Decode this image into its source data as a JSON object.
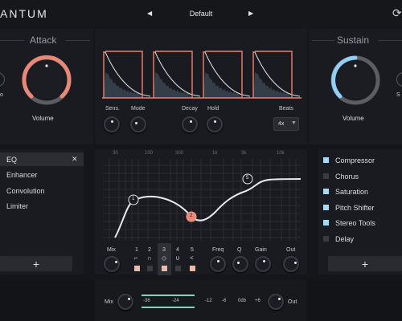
{
  "header": {
    "brand": "ANTUM",
    "preset_name": "Default",
    "prev_icon": "triangle-left-icon",
    "next_icon": "triangle-right-icon",
    "sync_icon": "refresh-icon"
  },
  "attack": {
    "title": "Attack",
    "volume_label": "Volume",
    "cut_label": "o"
  },
  "sustain": {
    "title": "Sustain",
    "volume_label": "Volume",
    "cut_label": "S"
  },
  "trigger": {
    "sens_label": "Sens.",
    "mode_label": "Mode",
    "decay_label": "Decay",
    "hold_label": "Hold",
    "beats_label": "Beats",
    "beats_value": "4x",
    "beats_options": [
      "4x"
    ]
  },
  "left_chain": {
    "items": [
      {
        "label": "EQ",
        "selected": true,
        "close": "✕"
      },
      {
        "label": "Enhancer",
        "selected": false
      },
      {
        "label": "Convolution",
        "selected": false
      },
      {
        "label": "Limiter",
        "selected": false
      }
    ],
    "add_label": "+"
  },
  "eq": {
    "freq_ticks": [
      "30",
      "100",
      "300",
      "1k",
      "3k",
      "10k"
    ],
    "node_labels": [
      "1",
      "2",
      "5"
    ],
    "band_numbers": [
      "1",
      "2",
      "3",
      "4",
      "5"
    ],
    "mix_label": "Mix",
    "freq_label": "Freq",
    "q_label": "Q",
    "gain_label": "Gain",
    "out_label": "Out"
  },
  "right_chain": {
    "items": [
      {
        "label": "Compressor",
        "enabled": true
      },
      {
        "label": "Chorus",
        "enabled": false
      },
      {
        "label": "Saturation",
        "enabled": true
      },
      {
        "label": "Pitch Shifter",
        "enabled": true
      },
      {
        "label": "Stereo Tools",
        "enabled": true
      },
      {
        "label": "Delay",
        "enabled": false
      }
    ],
    "add_label": "+"
  },
  "footer": {
    "mix_label": "Mix",
    "out_label": "Out",
    "meter_ticks": [
      "-36",
      "-24",
      "-12",
      "-6",
      "0db",
      "+6"
    ]
  },
  "colors": {
    "attack_accent": "#f0806e",
    "sustain_accent": "#8fd0ff",
    "meter_accent": "#7fd3c0",
    "background": "#15161a",
    "panel": "#1d1e23"
  }
}
